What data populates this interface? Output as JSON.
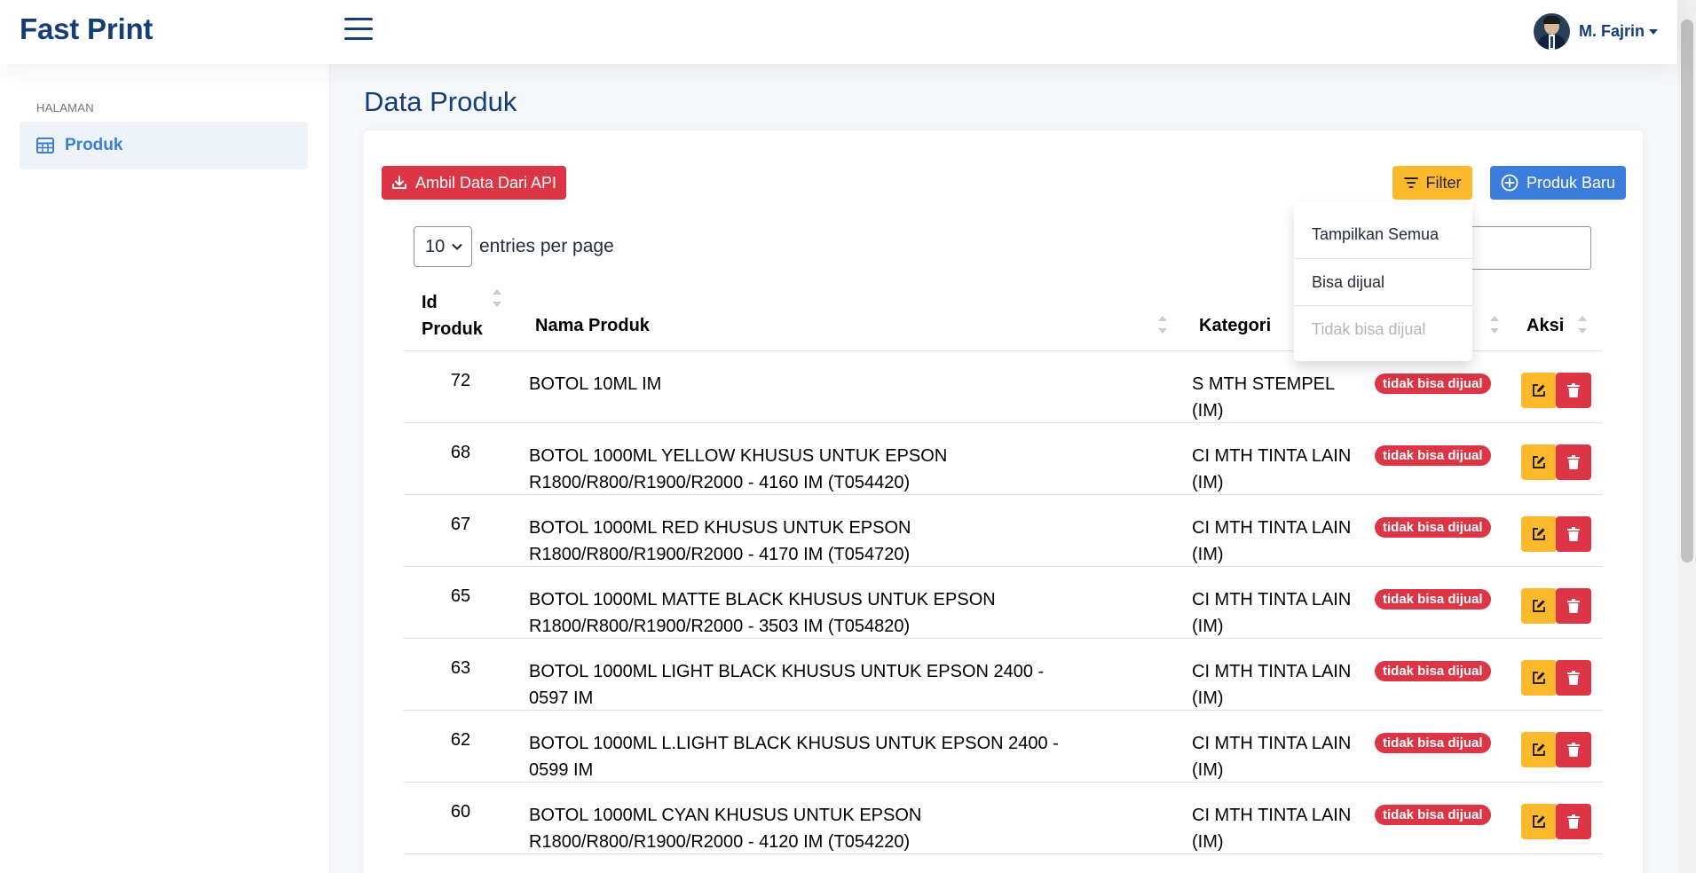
{
  "app": {
    "brand": "Fast Print"
  },
  "user": {
    "name": "M. Fajrin"
  },
  "sidebar": {
    "header": "HALAMAN",
    "items": [
      {
        "label": "Produk",
        "icon": "table-icon"
      }
    ]
  },
  "page": {
    "title": "Data Produk"
  },
  "toolbar": {
    "api_label": "Ambil Data Dari API",
    "filter_label": "Filter",
    "new_label": "Produk Baru"
  },
  "entries": {
    "value": "10",
    "label": "entries per page"
  },
  "filter_menu": {
    "items": [
      "Tampilkan Semua",
      "Bisa dijual",
      "Tidak bisa dijual"
    ]
  },
  "table": {
    "headers": {
      "id_line1": "Id",
      "id_line2": "Produk",
      "name": "Nama Produk",
      "kategori": "Kategori",
      "aksi": "Aksi"
    },
    "rows": [
      {
        "id": "72",
        "name": "BOTOL 10ML IM",
        "kategori": "S MTH STEMPEL (IM)",
        "status": "tidak bisa dijual"
      },
      {
        "id": "68",
        "name": "BOTOL 1000ML YELLOW KHUSUS UNTUK EPSON R1800/R800/R1900/R2000 - 4160 IM (T054420)",
        "kategori": "CI MTH TINTA LAIN (IM)",
        "status": "tidak bisa dijual"
      },
      {
        "id": "67",
        "name": "BOTOL 1000ML RED KHUSUS UNTUK EPSON R1800/R800/R1900/R2000 - 4170 IM (T054720)",
        "kategori": "CI MTH TINTA LAIN (IM)",
        "status": "tidak bisa dijual"
      },
      {
        "id": "65",
        "name": "BOTOL 1000ML MATTE BLACK KHUSUS UNTUK EPSON R1800/R800/R1900/R2000 - 3503 IM (T054820)",
        "kategori": "CI MTH TINTA LAIN (IM)",
        "status": "tidak bisa dijual"
      },
      {
        "id": "63",
        "name": "BOTOL 1000ML LIGHT BLACK KHUSUS UNTUK EPSON 2400 - 0597 IM",
        "kategori": "CI MTH TINTA LAIN (IM)",
        "status": "tidak bisa dijual"
      },
      {
        "id": "62",
        "name": "BOTOL 1000ML L.LIGHT BLACK KHUSUS UNTUK EPSON 2400 - 0599 IM",
        "kategori": "CI MTH TINTA LAIN (IM)",
        "status": "tidak bisa dijual"
      },
      {
        "id": "60",
        "name": "BOTOL 1000ML CYAN KHUSUS UNTUK EPSON R1800/R800/R1900/R2000 - 4120 IM (T054220)",
        "kategori": "CI MTH TINTA LAIN (IM)",
        "status": "tidak bisa dijual"
      }
    ]
  },
  "colors": {
    "brand": "#153d77",
    "primary": "#3b7ddd",
    "danger": "#dc3545",
    "warning": "#fcb92c"
  }
}
